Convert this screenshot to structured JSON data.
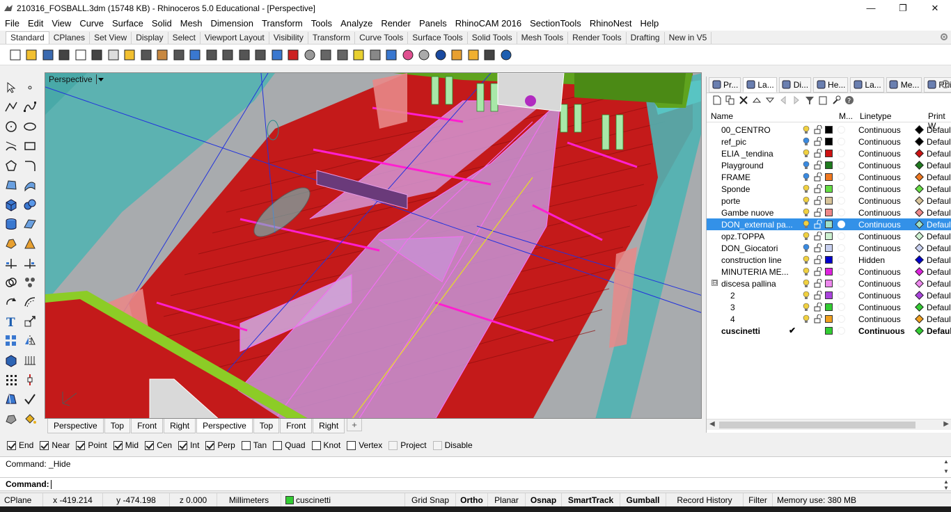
{
  "window": {
    "title": "210316_FOSBALL.3dm (15748 KB) - Rhinoceros 5.0 Educational - [Perspective]",
    "minimize": "—",
    "restore": "❐",
    "close": "✕"
  },
  "menu": [
    "File",
    "Edit",
    "View",
    "Curve",
    "Surface",
    "Solid",
    "Mesh",
    "Dimension",
    "Transform",
    "Tools",
    "Analyze",
    "Render",
    "Panels",
    "RhinoCAM 2016",
    "SectionTools",
    "RhinoNest",
    "Help"
  ],
  "toolbar_tabs": [
    "Standard",
    "CPlanes",
    "Set View",
    "Display",
    "Select",
    "Viewport Layout",
    "Visibility",
    "Transform",
    "Curve Tools",
    "Surface Tools",
    "Solid Tools",
    "Mesh Tools",
    "Render Tools",
    "Drafting",
    "New in V5"
  ],
  "main_toolbar_icons": [
    "new-icon",
    "open-icon",
    "save-icon",
    "print-icon",
    "import-icon",
    "cut-icon",
    "copy-icon",
    "paste-icon",
    "undo-icon",
    "pan-icon",
    "move-icon",
    "zoom-icon",
    "zoom-window-icon",
    "zoom-extents-icon",
    "zoom-selected-icon",
    "rotate-view-icon",
    "four-viewports-icon",
    "car-icon",
    "circle-icon",
    "shade-icon",
    "wireframe-icon",
    "light-icon",
    "properties-icon",
    "render-icon",
    "color-wheel-icon",
    "sphere-icon",
    "sphere-render-icon",
    "arrow-tool-icon",
    "settings-icon",
    "macro-icon",
    "help-icon"
  ],
  "viewport": {
    "name": "Perspective"
  },
  "viewport_tabs": [
    "Perspective",
    "Top",
    "Front",
    "Right",
    "Perspective",
    "Top",
    "Front",
    "Right"
  ],
  "viewport_tab_add": "+",
  "osnaps": [
    {
      "label": "End",
      "checked": true
    },
    {
      "label": "Near",
      "checked": true
    },
    {
      "label": "Point",
      "checked": true
    },
    {
      "label": "Mid",
      "checked": true
    },
    {
      "label": "Cen",
      "checked": true
    },
    {
      "label": "Int",
      "checked": true
    },
    {
      "label": "Perp",
      "checked": true
    },
    {
      "label": "Tan",
      "checked": false
    },
    {
      "label": "Quad",
      "checked": false
    },
    {
      "label": "Knot",
      "checked": false
    },
    {
      "label": "Vertex",
      "checked": false
    },
    {
      "label": "Project",
      "checked": false,
      "disabled": true
    },
    {
      "label": "Disable",
      "checked": false,
      "disabled": true
    }
  ],
  "command": {
    "history": "Command: _Hide",
    "prompt": "Command:"
  },
  "status": {
    "cplane": "CPlane",
    "x": "x -419.214",
    "y": "y -474.198",
    "z": "z 0.000",
    "units": "Millimeters",
    "layer": "cuscinetti",
    "layer_color": "#33cc33",
    "grid_snap": "Grid Snap",
    "ortho": "Ortho",
    "planar": "Planar",
    "osnap": "Osnap",
    "smarttrack": "SmartTrack",
    "gumball": "Gumball",
    "record_history": "Record History",
    "filter": "Filter",
    "memory": "Memory use: 380 MB"
  },
  "panel": {
    "tabs": [
      {
        "label": "Pr...",
        "icon": "properties-icon"
      },
      {
        "label": "La...",
        "icon": "layers-icon",
        "active": true
      },
      {
        "label": "Di...",
        "icon": "display-icon"
      },
      {
        "label": "He...",
        "icon": "help-icon"
      },
      {
        "label": "La...",
        "icon": "layout-icon"
      },
      {
        "label": "Me...",
        "icon": "materials-icon"
      },
      {
        "label": "Rhi...",
        "icon": "rhino-icon"
      }
    ],
    "columns": {
      "name": "Name",
      "material": "M...",
      "linetype": "Linetype",
      "print_width": "Print W"
    },
    "layers": [
      {
        "name": "00_CENTRO",
        "indent": 0,
        "color": "#000000",
        "bulb": "#f0d040",
        "linetype": "Continuous",
        "print_color": "#000000",
        "print_width": "Default"
      },
      {
        "name": "ref_pic",
        "indent": 0,
        "color": "#000000",
        "bulb": "#3a8ae0",
        "linetype": "Continuous",
        "print_color": "#000000",
        "print_width": "Default"
      },
      {
        "name": "ELIA _tendina",
        "indent": 0,
        "color": "#cc1111",
        "bulb": "#f0d040",
        "linetype": "Continuous",
        "print_color": "#cc1111",
        "print_width": "Default"
      },
      {
        "name": "Playground",
        "indent": 0,
        "color": "#1e7a1e",
        "bulb": "#3a8ae0",
        "linetype": "Continuous",
        "print_color": "#1e7a1e",
        "print_width": "Default"
      },
      {
        "name": "FRAME",
        "indent": 0,
        "color": "#f07820",
        "bulb": "#3a8ae0",
        "linetype": "Continuous",
        "print_color": "#f07820",
        "print_width": "Default"
      },
      {
        "name": "Sponde",
        "indent": 0,
        "color": "#66dd44",
        "bulb": "#f0d040",
        "linetype": "Continuous",
        "print_color": "#66dd44",
        "print_width": "Default"
      },
      {
        "name": "porte",
        "indent": 0,
        "color": "#d8c49a",
        "bulb": "#f0d040",
        "linetype": "Continuous",
        "print_color": "#d8c49a",
        "print_width": "Default"
      },
      {
        "name": "Gambe nuove",
        "indent": 0,
        "color": "#ee8888",
        "bulb": "#f0d040",
        "linetype": "Continuous",
        "print_color": "#ee8888",
        "print_width": "Default"
      },
      {
        "name": "DON_external pa...",
        "indent": 0,
        "color": "#9fe0c8",
        "bulb": "#f0d040",
        "linetype": "Continuous",
        "print_color": "#9fe0c8",
        "print_width": "Default",
        "selected": true
      },
      {
        "name": "opz.TOPPA",
        "indent": 0,
        "color": "#ccf0d0",
        "bulb": "#f0d040",
        "linetype": "Continuous",
        "print_color": "#ccf0d0",
        "print_width": "Default"
      },
      {
        "name": "DON_Giocatori",
        "indent": 0,
        "color": "#c8d0f0",
        "bulb": "#3a8ae0",
        "linetype": "Continuous",
        "print_color": "#c8d0f0",
        "print_width": "Default"
      },
      {
        "name": "construction line",
        "indent": 0,
        "color": "#0000cc",
        "bulb": "#f0d040",
        "linetype": "Hidden",
        "print_color": "#0000cc",
        "print_width": "Default"
      },
      {
        "name": "MINUTERIA ME...",
        "indent": 0,
        "color": "#dd22dd",
        "bulb": "#f0d040",
        "linetype": "Continuous",
        "print_color": "#dd22dd",
        "print_width": "Default"
      },
      {
        "name": "discesa pallina",
        "indent": 0,
        "color": "#ee88ee",
        "bulb": "#f0d040",
        "linetype": "Continuous",
        "print_color": "#ee88ee",
        "print_width": "Default",
        "expander": "⊟"
      },
      {
        "name": "2",
        "indent": 1,
        "color": "#aa44dd",
        "bulb": "#f0d040",
        "linetype": "Continuous",
        "print_color": "#aa44dd",
        "print_width": "Default"
      },
      {
        "name": "3",
        "indent": 1,
        "color": "#33cc33",
        "bulb": "#f0d040",
        "linetype": "Continuous",
        "print_color": "#33cc33",
        "print_width": "Default"
      },
      {
        "name": "4",
        "indent": 1,
        "color": "#f0a020",
        "bulb": "#f0d040",
        "linetype": "Continuous",
        "print_color": "#f0a020",
        "print_width": "Default"
      },
      {
        "name": "cuscinetti",
        "indent": 0,
        "color": "#33cc33",
        "bulb": "",
        "linetype": "Continuous",
        "print_color": "#33cc33",
        "print_width": "Default",
        "current": true,
        "check": "✔"
      }
    ]
  }
}
